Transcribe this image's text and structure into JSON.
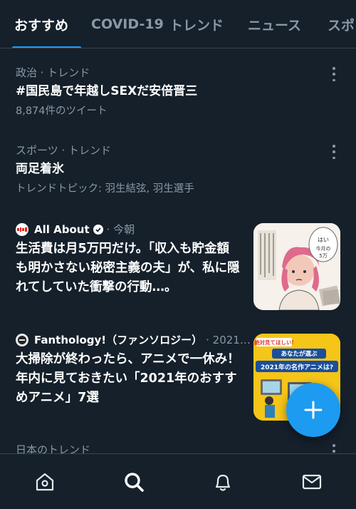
{
  "tabs": [
    {
      "label": "おすすめ",
      "active": true
    },
    {
      "label": "COVID-19",
      "active": false
    },
    {
      "label": "トレンド",
      "active": false
    },
    {
      "label": "ニュース",
      "active": false
    },
    {
      "label": "スポ",
      "active": false
    }
  ],
  "trends": [
    {
      "meta": "政治 · トレンド",
      "title": "#国民島で年越しSEXだ安倍晋三",
      "sub": "8,874件のツイート"
    },
    {
      "meta": "スポーツ · トレンド",
      "title": "両足着氷",
      "sub": "トレンドトピック: 羽生結弦, 羽生選手"
    }
  ],
  "news": [
    {
      "source": "All About",
      "time": "· 今朝",
      "verified": true,
      "title": "生活費は月5万円だけ。「収入も貯金額も明かさない秘密主義の夫」が、私に隠れてしていた衝撃の行動…。",
      "thumb_text": "はい今月の5万"
    },
    {
      "source": "Fanthology!（ファンソロジー）",
      "time": "· 2021…",
      "verified": false,
      "title": "大掃除が終わったら、アニメで一休み！ 年内に見ておきたい「2021年のおすすめアニメ」7選",
      "thumb_text": {
        "line1": "絶対見てほしい!",
        "line2": "あなたが選ぶ",
        "line3": "2021年の名作アニメは?"
      }
    }
  ],
  "section": {
    "label": "日本のトレンド"
  },
  "fab": {
    "icon": "plus-icon"
  },
  "bottom_nav": [
    {
      "icon": "home-icon"
    },
    {
      "icon": "search-icon"
    },
    {
      "icon": "bell-icon"
    },
    {
      "icon": "mail-icon"
    }
  ],
  "colors": {
    "background": "#15202b",
    "accent": "#1d9bf0",
    "secondary_text": "#8b98a5",
    "divider": "#38444d"
  }
}
